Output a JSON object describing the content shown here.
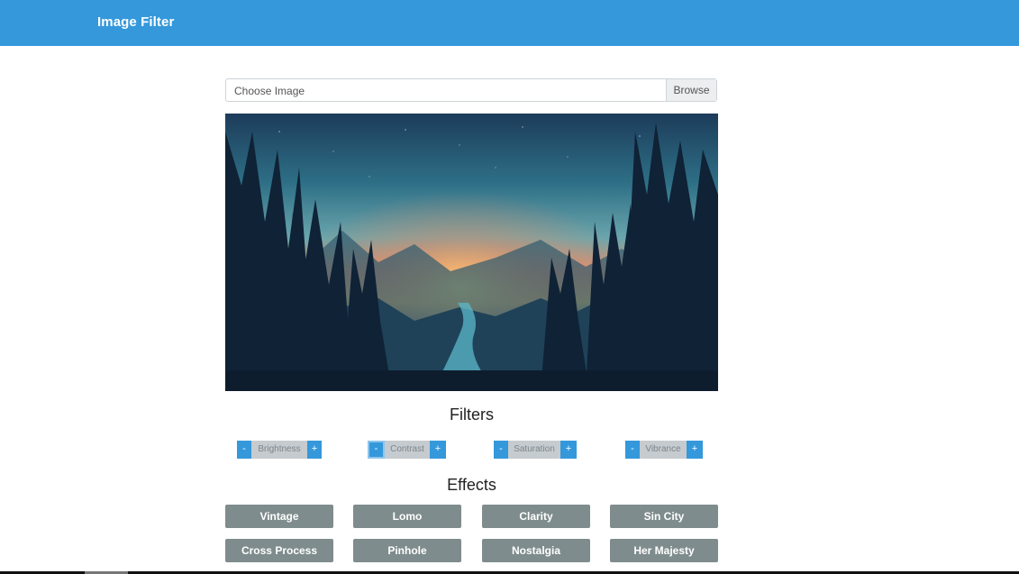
{
  "app": {
    "title": "Image Filter"
  },
  "upload": {
    "label": "Choose Image",
    "browse_label": "Browse"
  },
  "image": {
    "description_icon": "landscape-image"
  },
  "filters": {
    "title": "Filters",
    "items": [
      {
        "label": "Brightness",
        "minus": "-",
        "plus": "+"
      },
      {
        "label": "Contrast",
        "minus": "-",
        "plus": "+"
      },
      {
        "label": "Saturation",
        "minus": "-",
        "plus": "+"
      },
      {
        "label": "Vibrance",
        "minus": "-",
        "plus": "+"
      }
    ]
  },
  "effects": {
    "title": "Effects",
    "items": [
      "Vintage",
      "Lomo",
      "Clarity",
      "Sin City",
      "Cross Process",
      "Pinhole",
      "Nostalgia",
      "Her Majesty"
    ]
  },
  "colors": {
    "accent": "#3498db",
    "effect_button": "#7f8c8d",
    "filter_label_bg": "#c6cbcf"
  }
}
